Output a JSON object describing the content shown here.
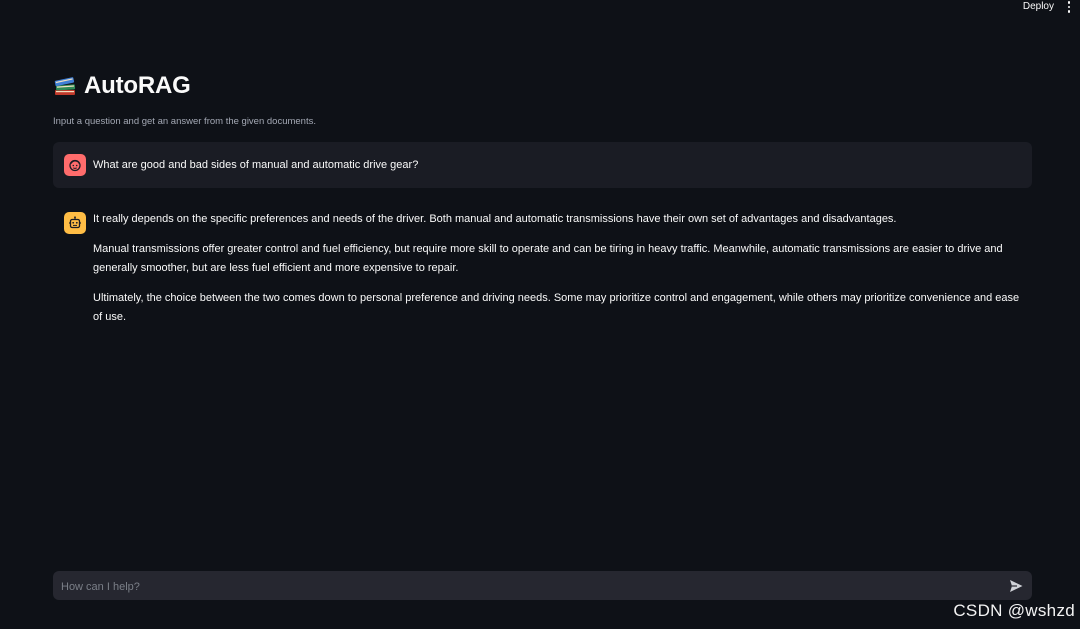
{
  "topbar": {
    "deploy_label": "Deploy",
    "menu_icon": "more-vertical-icon"
  },
  "header": {
    "title_icon": "books-icon",
    "title": "AutoRAG",
    "subtitle": "Input a question and get an answer from the given documents."
  },
  "messages": [
    {
      "role": "user",
      "avatar_icon": "user-face-icon",
      "avatar_color": "#ff6c6c",
      "text": "What are good and bad sides of manual and automatic drive gear?"
    },
    {
      "role": "assistant",
      "avatar_icon": "robot-icon",
      "avatar_color": "#ffbd45",
      "paragraphs": [
        "It really depends on the specific preferences and needs of the driver. Both manual and automatic transmissions have their own set of advantages and disadvantages.",
        "Manual transmissions offer greater control and fuel efficiency, but require more skill to operate and can be tiring in heavy traffic. Meanwhile, automatic transmissions are easier to drive and generally smoother, but are less fuel efficient and more expensive to repair.",
        "Ultimately, the choice between the two comes down to personal preference and driving needs. Some may prioritize control and engagement, while others may prioritize convenience and ease of use."
      ]
    }
  ],
  "chat_input": {
    "placeholder": "How can I help?",
    "value": "",
    "send_icon": "send-icon"
  },
  "watermark": "CSDN @wshzd",
  "colors": {
    "background": "#0e1117",
    "user_message_bg": "#1a1c24",
    "input_bg": "#262730"
  }
}
